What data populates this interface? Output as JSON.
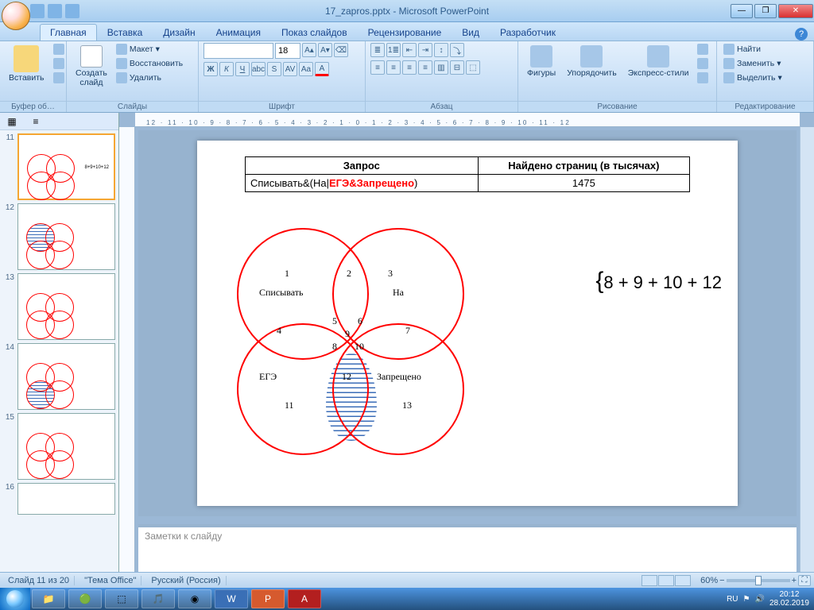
{
  "title": "17_zapros.pptx - Microsoft PowerPoint",
  "tabs": {
    "home": "Главная",
    "insert": "Вставка",
    "design": "Дизайн",
    "anim": "Анимация",
    "slideshow": "Показ слайдов",
    "review": "Рецензирование",
    "view": "Вид",
    "developer": "Разработчик"
  },
  "ribbon": {
    "clipboard": {
      "paste": "Вставить",
      "label": "Буфер об…"
    },
    "slides": {
      "new": "Создать\nслайд",
      "layout": "Макет",
      "reset": "Восстановить",
      "delete": "Удалить",
      "label": "Слайды"
    },
    "font": {
      "name": "",
      "size": "18",
      "label": "Шрифт",
      "bold": "Ж",
      "italic": "К",
      "underline": "Ч"
    },
    "para": {
      "label": "Абзац"
    },
    "drawing": {
      "shapes": "Фигуры",
      "arrange": "Упорядочить",
      "styles": "Экспресс-стили",
      "label": "Рисование"
    },
    "editing": {
      "find": "Найти",
      "replace": "Заменить",
      "select": "Выделить",
      "label": "Редактирование"
    }
  },
  "ruler": "12 · 11 · 10 · 9 · 8 · 7 · 6 · 5 · 4 · 3 · 2 · 1 · 0 · 1 · 2 · 3 · 4 · 5 · 6 · 7 · 8 · 9 · 10 · 11 · 12",
  "thumbs": {
    "n11": "11",
    "n12": "12",
    "n13": "13",
    "n14": "14",
    "n15": "15",
    "n16": "16"
  },
  "slide": {
    "th1": "Запрос",
    "th2": "Найдено страниц (в тысячах)",
    "queryPrefix": "Списывать&(На|",
    "queryHighlight": "ЕГЭ&Запрещено",
    "querySuffix": ")",
    "pages": "1475",
    "labels": {
      "l1": "1",
      "l2": "2",
      "l3": "3",
      "l4": "4",
      "l5": "5",
      "l6": "6",
      "l7": "7",
      "l8": "8",
      "l9": "9",
      "l10": "10",
      "l11": "11",
      "l12": "12",
      "l13": "13",
      "cA": "Списывать",
      "cB": "На",
      "cC": "ЕГЭ",
      "cD": "Запрещено"
    },
    "formula": "8 + 9 + 10 + 12"
  },
  "notes": "Заметки к слайду",
  "status": {
    "slide": "Слайд 11 из 20",
    "theme": "\"Тема Office\"",
    "lang": "Русский (Россия)",
    "zoom": "60%"
  },
  "tray": {
    "lang": "RU",
    "time": "20:12",
    "date": "28.02.2019"
  }
}
